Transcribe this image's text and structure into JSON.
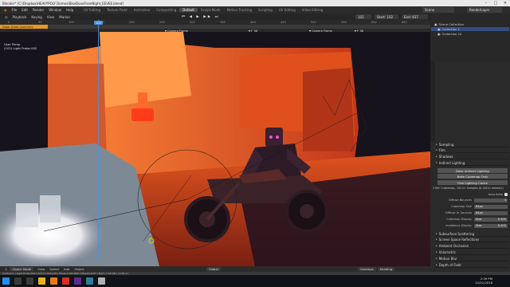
{
  "window": {
    "title": "Blender* [C:\\Dropbox\\HEAVYPOLY Demos\\BikeDoneFromNight_EEVEE.blend]",
    "controls": [
      "–",
      "□",
      "✕"
    ]
  },
  "menubar": {
    "menus": [
      "File",
      "Edit",
      "Render",
      "Window",
      "Help"
    ],
    "workspaces": [
      "UV Editing",
      "Texture Paint",
      "Animation",
      "Compositing",
      "Default",
      "Sculpt Mode",
      "Motion Tracking",
      "Scripting",
      "UV Editing",
      "Video Editing"
    ],
    "active_workspace_index": 4,
    "scene": "Scene",
    "view_layer": "RenderLayer"
  },
  "timeline": {
    "buttons": [
      "Playback",
      "Keying",
      "View",
      "Marker"
    ],
    "current_frame": "102",
    "start_label": "Start:",
    "start": "102",
    "end_label": "End:",
    "end": "837",
    "ticks": [
      "0",
      "50",
      "100",
      "150",
      "200",
      "250",
      "300",
      "350",
      "400",
      "450",
      "500",
      "550",
      "600",
      "650"
    ],
    "playhead_label": "102",
    "summary_label": "Dope Sheet Summary",
    "markers": [
      "Camera Frame",
      "F_06",
      "Camera Frame",
      "F_06"
    ]
  },
  "viewport": {
    "perspective": "User Persp",
    "info": "(102) Light Probe.002"
  },
  "viewport_footer": {
    "items": [
      "Object Mode",
      "View",
      "Select",
      "Add",
      "Object",
      "Global",
      "Overlays",
      "Shading"
    ]
  },
  "statusbar": {
    "text": "Collection | Light Probe.002 | Verts:1,340,916 | Faces:1,302,880 | Objects:0/97 | Mem: 1.06 GB | v2.80.11"
  },
  "outliner": {
    "rows": [
      "Scene Collection",
      "Collection 1",
      "Collection 10"
    ],
    "selected_index": 1
  },
  "properties": {
    "sections_top": [
      "Sampling",
      "Film",
      "Shadows",
      "Indirect Lighting"
    ],
    "buttons": [
      "Bake Indirect Lighting",
      "Bake Cubemap Only",
      "Free Lighting Cache"
    ],
    "cache_info": "3 Ref. Cubemaps, 102 Irr. Samples (0.148 in memory)",
    "auto_bake_label": "Auto Bake",
    "fields": [
      {
        "label": "Diffuse Bounces",
        "value": "3"
      },
      {
        "label": "Cubemap Size",
        "value": "64px"
      },
      {
        "label": "Diffuse Irr Sources",
        "value": "64px"
      },
      {
        "label": "Cubemap Display",
        "value": "0.300",
        "prefix": "Size"
      },
      {
        "label": "Irradiance Display",
        "value": "0.100",
        "prefix": "Size"
      }
    ],
    "sections_bottom": [
      "Subsurface Scattering",
      "Screen Space Reflections",
      "Ambient Occlusion",
      "Volumetric",
      "Motion Blur",
      "Depth of Field"
    ]
  },
  "taskbar": {
    "time": "2:39 PM",
    "date": "10/21/2018"
  }
}
